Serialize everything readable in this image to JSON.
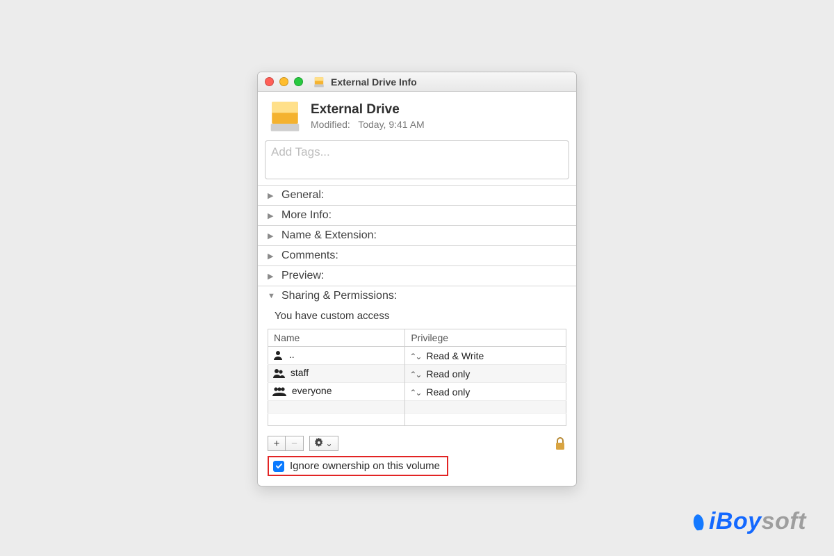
{
  "window": {
    "title": "External Drive Info"
  },
  "header": {
    "name": "External Drive",
    "modified_label": "Modified:",
    "modified_value": "Today, 9:41 AM"
  },
  "tags": {
    "placeholder": "Add Tags..."
  },
  "sections": {
    "general": "General:",
    "more_info": "More Info:",
    "name_ext": "Name & Extension:",
    "comments": "Comments:",
    "preview": "Preview:",
    "sharing": "Sharing & Permissions:"
  },
  "sharing": {
    "custom_access": "You have custom access",
    "columns": {
      "name": "Name",
      "privilege": "Privilege"
    },
    "rows": [
      {
        "icon": "person",
        "name": "..",
        "privilege": "Read & Write"
      },
      {
        "icon": "group",
        "name": "staff",
        "privilege": "Read only"
      },
      {
        "icon": "group",
        "name": "everyone",
        "privilege": "Read only"
      }
    ]
  },
  "toolbar": {
    "add": "+",
    "remove": "−",
    "gear": "✽",
    "dropdown": "⌄"
  },
  "ignore": {
    "checked": true,
    "label": "Ignore ownership on this volume"
  },
  "watermark": {
    "brand_prefix": "iBoy",
    "brand_suffix": "soft"
  }
}
